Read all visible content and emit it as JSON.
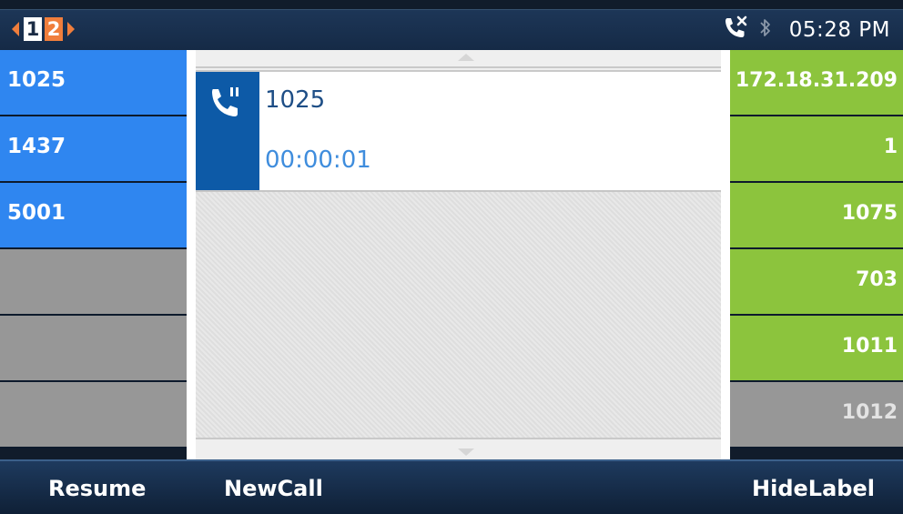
{
  "status_bar": {
    "pages": [
      "1",
      "2"
    ],
    "active_page": "1",
    "clock": "05:28 PM",
    "icons": [
      "missed-call-icon",
      "bluetooth-icon"
    ]
  },
  "line_keys": [
    {
      "label": "1025",
      "state": "active"
    },
    {
      "label": "1437",
      "state": "active"
    },
    {
      "label": "5001",
      "state": "active"
    },
    {
      "label": "",
      "state": "empty"
    },
    {
      "label": "",
      "state": "empty"
    },
    {
      "label": "",
      "state": "empty"
    }
  ],
  "blf_keys": [
    {
      "label": "172.18.31.209",
      "state": "idle"
    },
    {
      "label": "1",
      "state": "idle"
    },
    {
      "label": "1075",
      "state": "idle"
    },
    {
      "label": "703",
      "state": "idle"
    },
    {
      "label": "1011",
      "state": "idle"
    },
    {
      "label": "1012",
      "state": "unavailable"
    }
  ],
  "call": {
    "number": "1025",
    "duration": "00:00:01",
    "icon": "call-hold-icon"
  },
  "softkeys": {
    "left": "Resume",
    "middle": "NewCall",
    "right": "HideLabel"
  },
  "colors": {
    "line_key_active": "#2f86f0",
    "key_empty": "#979797",
    "blf_idle": "#8cc43d",
    "call_icon_bg": "#0d5aa7",
    "page_indicator": "#f07e3c"
  }
}
